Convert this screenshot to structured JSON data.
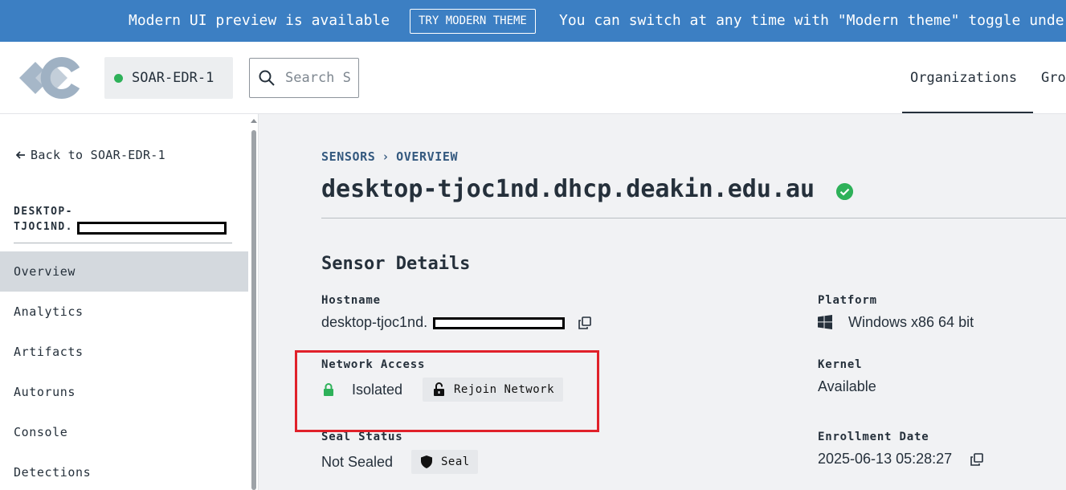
{
  "banner": {
    "message": "Modern UI preview is available",
    "button_label": "TRY MODERN THEME",
    "hint": "You can switch at any time with \"Modern theme\" toggle unde"
  },
  "header": {
    "org_name": "SOAR-EDR-1",
    "org_status_color": "#2eb159",
    "search_placeholder": "Search S",
    "nav_organizations": "Organizations",
    "nav_groups_partial": "Gro"
  },
  "sidebar": {
    "back_label": "Back to SOAR-EDR-1",
    "host_line1": "DESKTOP-",
    "host_line2": "TJOC1ND.",
    "items": [
      {
        "label": "Overview",
        "active": true
      },
      {
        "label": "Analytics"
      },
      {
        "label": "Artifacts"
      },
      {
        "label": "Autoruns"
      },
      {
        "label": "Console"
      },
      {
        "label": "Detections"
      }
    ]
  },
  "main": {
    "breadcrumb": [
      "SENSORS",
      "OVERVIEW"
    ],
    "breadcrumb_separator": "›",
    "title": "desktop-tjoc1nd.dhcp.deakin.edu.au",
    "section_title": "Sensor Details",
    "hostname_label": "Hostname",
    "hostname_value": "desktop-tjoc1nd.",
    "network_label": "Network Access",
    "network_value": "Isolated",
    "rejoin_button": "Rejoin Network",
    "seal_label": "Seal Status",
    "seal_value": "Not Sealed",
    "seal_button": "Seal",
    "platform_label": "Platform",
    "platform_value": "Windows x86 64 bit",
    "kernel_label": "Kernel",
    "kernel_value": "Available",
    "enrollment_label": "Enrollment Date",
    "enrollment_value": "2025-06-13 05:28:27"
  },
  "colors": {
    "banner": "#3c7fc3",
    "accent_green": "#2eb159",
    "breadcrumb": "#34597f",
    "highlight": "#e0212a"
  }
}
